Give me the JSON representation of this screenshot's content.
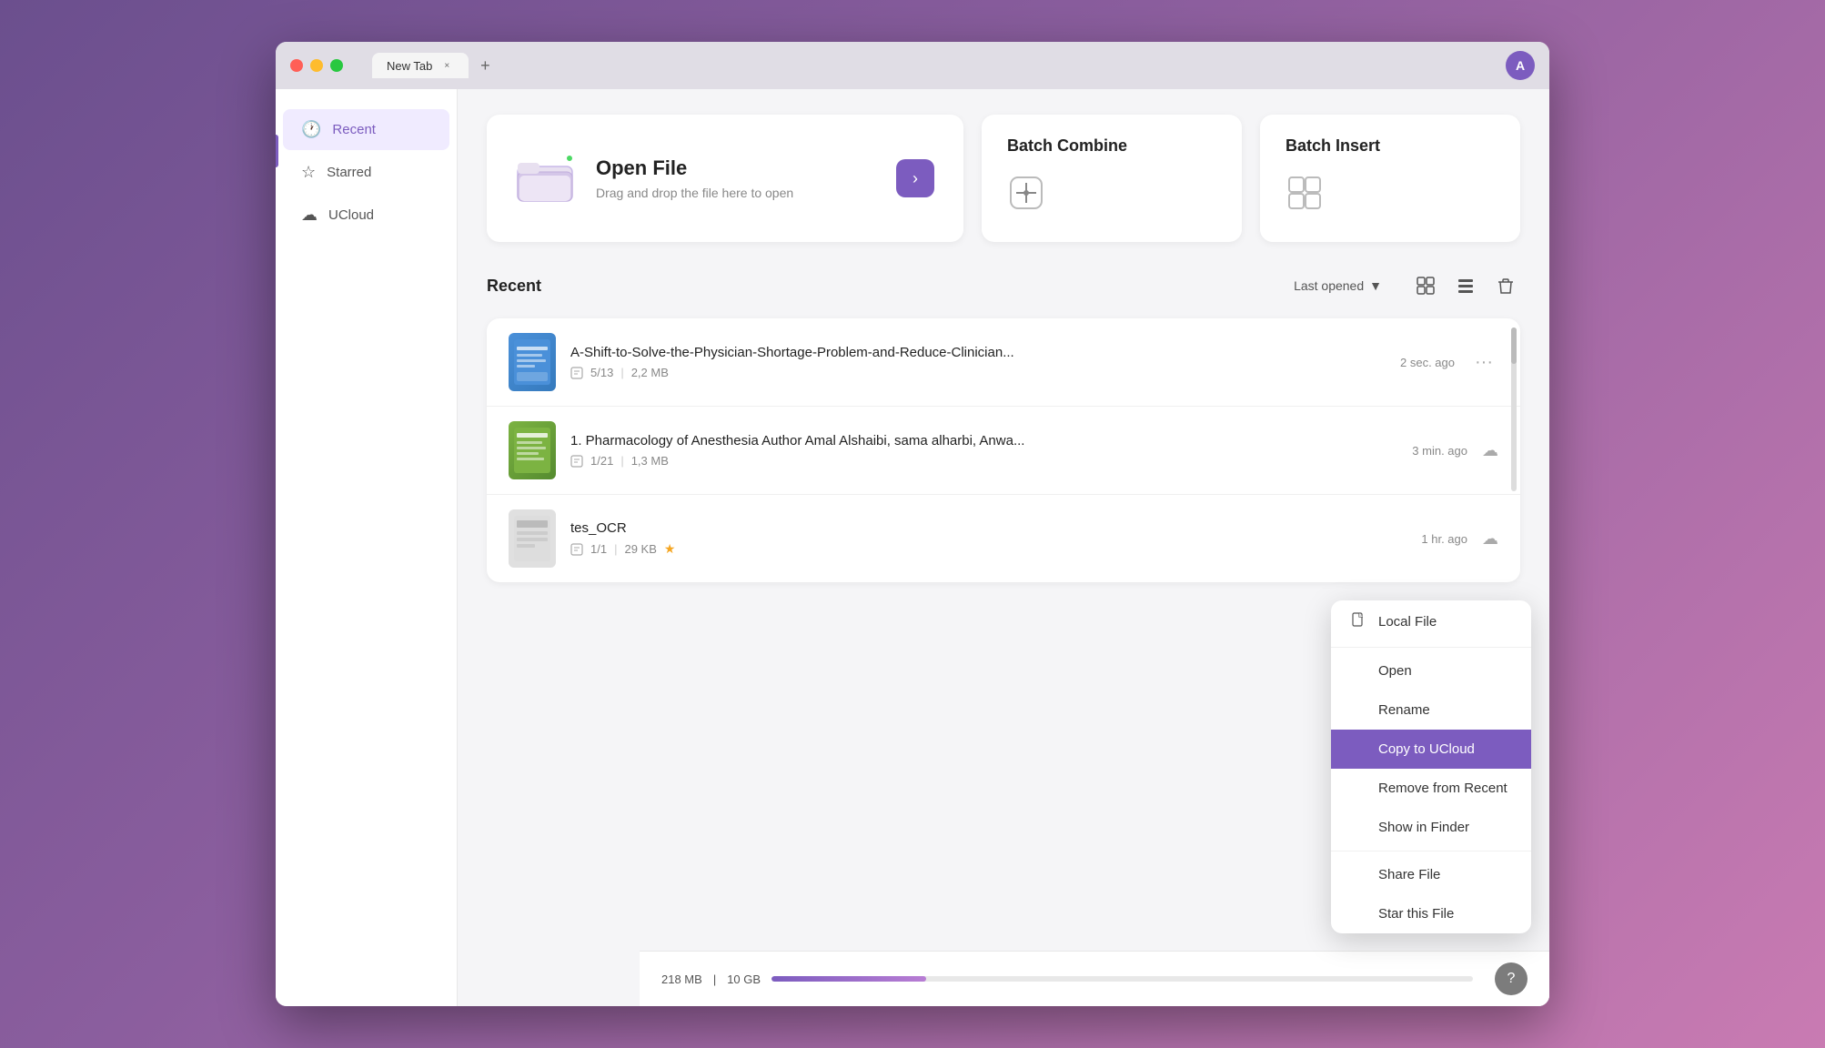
{
  "window": {
    "title": "New Tab",
    "tab_close": "×",
    "tab_add": "+",
    "user_initial": "A"
  },
  "sidebar": {
    "items": [
      {
        "id": "recent",
        "label": "Recent",
        "icon": "🕐",
        "active": true
      },
      {
        "id": "starred",
        "label": "Starred",
        "icon": "☆",
        "active": false
      },
      {
        "id": "ucloud",
        "label": "UCloud",
        "icon": "☁",
        "active": false
      }
    ]
  },
  "open_file": {
    "title": "Open File",
    "subtitle": "Drag and drop the file here to open",
    "arrow": "›"
  },
  "batch_combine": {
    "title": "Batch Combine",
    "icon": "⊕"
  },
  "batch_insert": {
    "title": "Batch Insert",
    "icon": "⊞"
  },
  "recent": {
    "title": "Recent",
    "sort_label": "Last opened",
    "sort_arrow": "▼"
  },
  "files": [
    {
      "name": "A-Shift-to-Solve-the-Physician-Shortage-Problem-and-Reduce-Clinician...",
      "pages": "5/13",
      "size": "2,2 MB",
      "time": "2 sec. ago",
      "type": "blue",
      "cloud": false,
      "starred": false
    },
    {
      "name": "1. Pharmacology of Anesthesia Author Amal Alshaibi, sama alharbi, Anwa...",
      "pages": "1/21",
      "size": "1,3 MB",
      "time": "3 min. ago",
      "type": "green",
      "cloud": true,
      "starred": false
    },
    {
      "name": "tes_OCR",
      "pages": "1/1",
      "size": "29 KB",
      "time": "1 hr. ago",
      "type": "gray",
      "cloud": true,
      "starred": true
    }
  ],
  "storage": {
    "used": "218 MB",
    "total": "10 GB",
    "fill_percent": "22%"
  },
  "context_menu": {
    "items": [
      {
        "id": "local-file",
        "label": "Local File",
        "icon": "📄",
        "highlighted": false
      },
      {
        "id": "open",
        "label": "Open",
        "icon": "",
        "highlighted": false
      },
      {
        "id": "rename",
        "label": "Rename",
        "icon": "",
        "highlighted": false
      },
      {
        "id": "copy-ucloud",
        "label": "Copy to UCloud",
        "icon": "",
        "highlighted": true
      },
      {
        "id": "remove-recent",
        "label": "Remove from Recent",
        "icon": "",
        "highlighted": false
      },
      {
        "id": "show-finder",
        "label": "Show in Finder",
        "icon": "",
        "highlighted": false
      },
      {
        "id": "share-file",
        "label": "Share File",
        "icon": "",
        "highlighted": false
      },
      {
        "id": "star-file",
        "label": "Star this File",
        "icon": "",
        "highlighted": false
      }
    ]
  }
}
